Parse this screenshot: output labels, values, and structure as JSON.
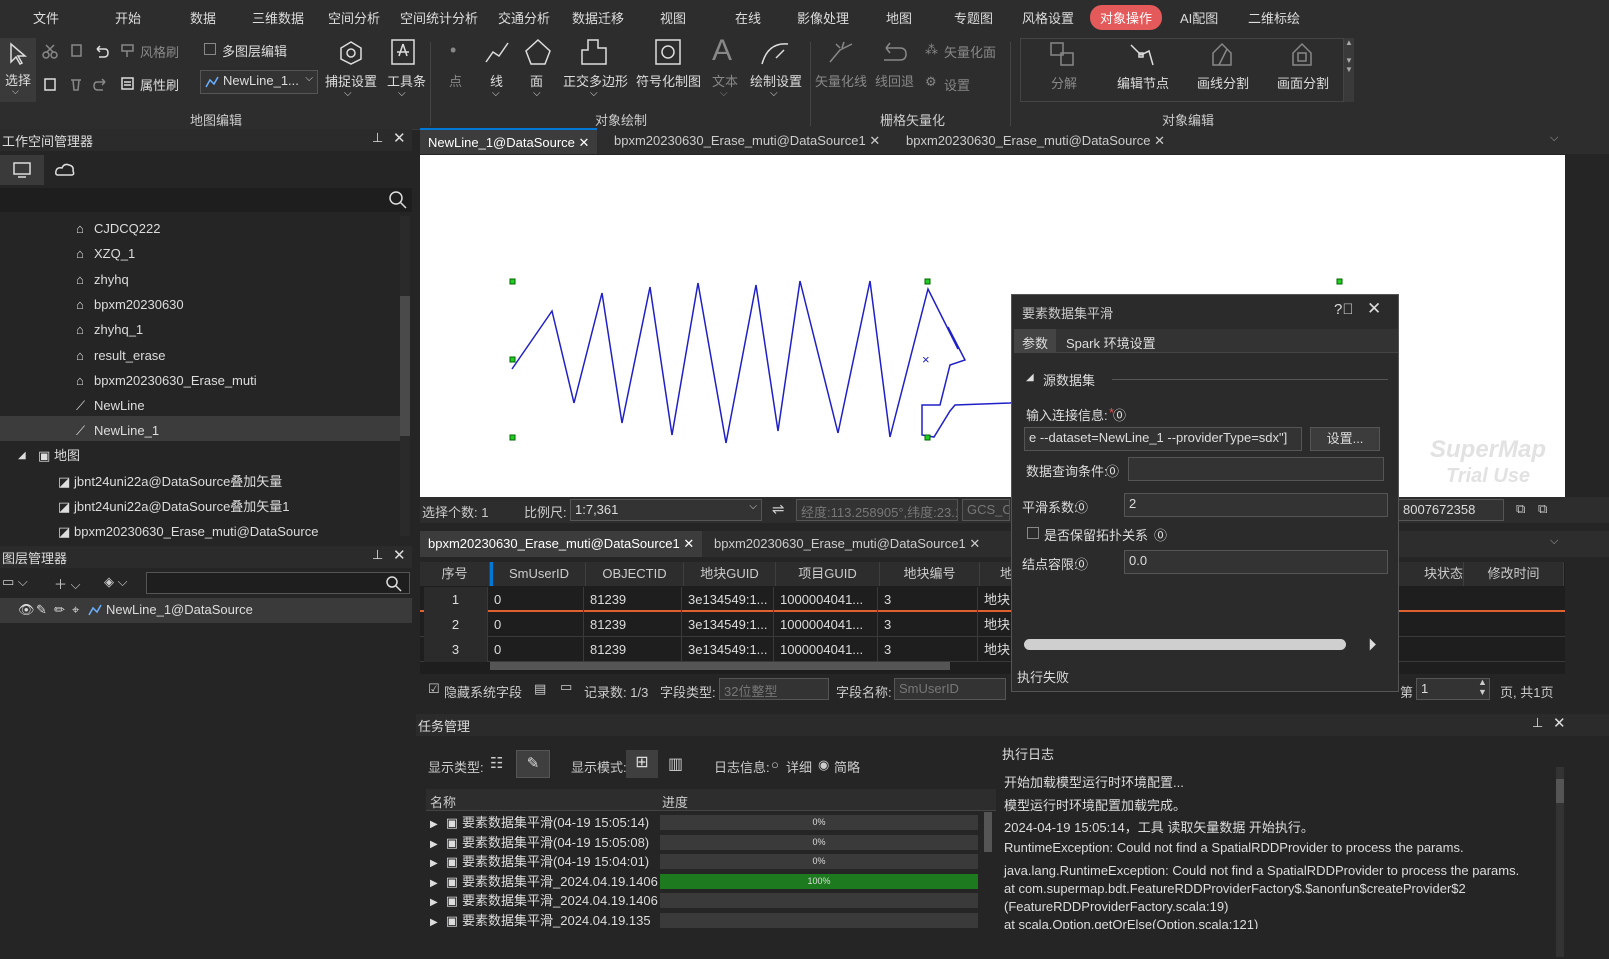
{
  "menu": {
    "tabs": [
      "文件",
      "开始",
      "数据",
      "三维数据",
      "空间分析",
      "空间统计分析",
      "交通分析",
      "数据迁移",
      "视图",
      "在线",
      "影像处理",
      "地图",
      "专题图",
      "风格设置",
      "对象操作",
      "AI配图",
      "二维标绘"
    ],
    "active": "对象操作"
  },
  "ribbon": {
    "select": "选择",
    "format_brush": "风格刷",
    "attr_brush": "属性刷",
    "multi_layer_edit": "多图层编辑",
    "layer_combo": "NewLine_1...",
    "snap": "捕捉设置",
    "toolbox": "工具条",
    "map_edit_group": "地图编辑",
    "point": "点",
    "line": "线",
    "polygon": "面",
    "ortho_polygon": "正交多边形",
    "symbol_draw": "符号化制图",
    "text": "文本",
    "draw_settings": "绘制设置",
    "object_draw_group": "对象绘制",
    "vec_to_line": "矢量化线",
    "line_back": "线回退",
    "vec_to_poly": "矢量化面",
    "settings": "设置",
    "raster_vec_group": "栅格矢量化",
    "decompose": "分解",
    "edit_nodes": "编辑节点",
    "split_by_line": "画线分割",
    "split_by_poly": "画面分割",
    "object_edit_group": "对象编辑"
  },
  "workspace": {
    "title": "工作空间管理器",
    "items": [
      "CJDCQ222",
      "XZQ_1",
      "zhyhq",
      "bpxm20230630",
      "zhyhq_1",
      "result_erase",
      "bpxm20230630_Erase_muti",
      "NewLine",
      "NewLine_1"
    ],
    "maps_label": "地图",
    "maps": [
      "jbnt24uni22a@DataSource叠加矢量",
      "jbnt24uni22a@DataSource叠加矢量1",
      "bpxm20230630_Erase_muti@DataSource"
    ]
  },
  "layers": {
    "title": "图层管理器",
    "item": "NewLine_1@DataSource"
  },
  "doc_tabs": [
    "NewLine_1@DataSource",
    "bpxm20230630_Erase_muti@DataSource1",
    "bpxm20230630_Erase_muti@DataSource"
  ],
  "map_status": {
    "selected": "选择个数: 1",
    "scale_label": "比例尺:",
    "scale": "1:7,361",
    "coords": "经度:113.258905°,纬度:23.1",
    "crs": "GCS_CH",
    "right_value": "8007672358"
  },
  "watermark": {
    "line1": "SuperMap",
    "line2": "Trial Use"
  },
  "attr_tabs": [
    "bpxm20230630_Erase_muti@DataSource1",
    "bpxm20230630_Erase_muti@DataSource1"
  ],
  "attr_table": {
    "headers": [
      "序号",
      "SmUserID",
      "OBJECTID",
      "地块GUID",
      "项目GUID",
      "地块编号",
      "地",
      "块状态",
      "修改时间"
    ],
    "rows": [
      [
        "1",
        "0",
        "81239",
        "3e134549:1...",
        "1000004041...",
        "3",
        "地块"
      ],
      [
        "2",
        "0",
        "81239",
        "3e134549:1...",
        "1000004041...",
        "3",
        "地块"
      ],
      [
        "3",
        "0",
        "81239",
        "3e134549:1...",
        "1000004041...",
        "3",
        "地块"
      ]
    ]
  },
  "attr_status": {
    "hide_sys": "隐藏系统字段",
    "records": "记录数: 1/3",
    "field_type_label": "字段类型:",
    "field_type": "32位整型",
    "field_name_label": "字段名称:",
    "field_name": "SmUserID",
    "page_label": "第",
    "page": "1",
    "page_total": "页, 共1页"
  },
  "dialog": {
    "title": "要素数据集平滑",
    "tab_params": "参数",
    "tab_spark": "Spark 环境设置",
    "section": "源数据集",
    "input_conn_label": "输入连接信息:",
    "input_conn_value": "e --dataset=NewLine_1 --providerType=sdx\"]",
    "settings_btn": "设置...",
    "query_label": "数据查询条件:",
    "query_value": "",
    "smooth_label": "平滑系数:",
    "smooth_value": "2",
    "topo_label": "是否保留拓扑关系",
    "tolerance_label": "结点容限:",
    "tolerance_value": "0.0",
    "status": "执行失败"
  },
  "task": {
    "title": "任务管理",
    "display_type": "显示类型:",
    "display_mode": "显示模式:",
    "log_info": "日志信息:",
    "detail": "详细",
    "brief": "简略",
    "col_name": "名称",
    "col_progress": "进度",
    "rows": [
      {
        "name": "要素数据集平滑(04-19 15:05:14)",
        "progress": "0%",
        "fill": 0
      },
      {
        "name": "要素数据集平滑(04-19 15:05:08)",
        "progress": "0%",
        "fill": 0
      },
      {
        "name": "要素数据集平滑(04-19 15:04:01)",
        "progress": "0%",
        "fill": 0
      },
      {
        "name": "要素数据集平滑_2024.04.19.1406",
        "progress": "100%",
        "fill": 1
      },
      {
        "name": "要素数据集平滑_2024.04.19.1406",
        "progress": "",
        "fill": 0
      },
      {
        "name": "要素数据集平滑_2024.04.19.135",
        "progress": "",
        "fill": 0
      }
    ]
  },
  "exec_log": {
    "title": "执行日志",
    "lines": [
      "开始加载模型运行时环境配置...",
      "模型运行时环境配置加载完成。",
      "2024-04-19 15:05:14，工具 读取矢量数据 开始执行。",
      "RuntimeException: Could not find a SpatialRDDProvider to process the params.",
      "java.lang.RuntimeException: Could not find a SpatialRDDProvider to process the params.",
      "            at com.supermap.bdt.FeatureRDDProviderFactory$.$anonfun$createProvider$2",
      "(FeatureRDDProviderFactory.scala:19)",
      "            at scala.Option.getOrElse(Option.scala:121)"
    ]
  }
}
